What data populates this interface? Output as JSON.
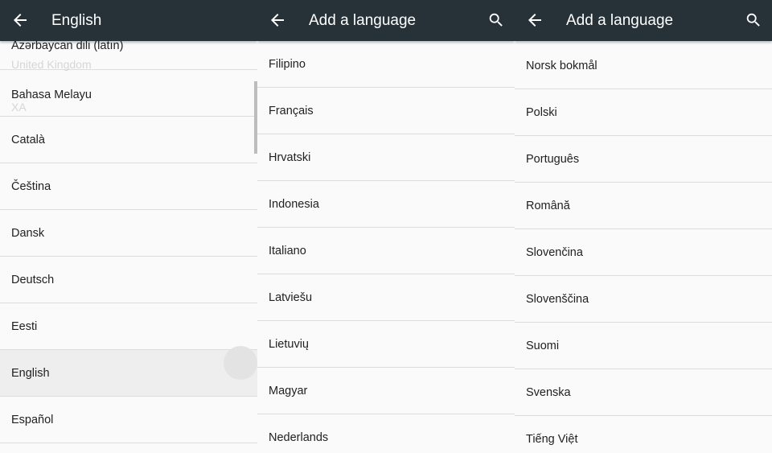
{
  "panel_english": {
    "title": "English",
    "items": [
      {
        "label": "Azərbaycan dili (latın)",
        "sub": "United Kingdom"
      },
      {
        "label": "Bahasa Melayu",
        "sub": "XA"
      },
      {
        "label": "Català"
      },
      {
        "label": "Čeština"
      },
      {
        "label": "Dansk"
      },
      {
        "label": "Deutsch"
      },
      {
        "label": "Eesti"
      },
      {
        "label": "English",
        "selected": true
      },
      {
        "label": "Español"
      }
    ]
  },
  "panel_add_1": {
    "title": "Add a language",
    "items": [
      {
        "label": "Filipino"
      },
      {
        "label": "Français"
      },
      {
        "label": "Hrvatski"
      },
      {
        "label": "Indonesia"
      },
      {
        "label": "Italiano"
      },
      {
        "label": "Latviešu"
      },
      {
        "label": "Lietuvių"
      },
      {
        "label": "Magyar"
      },
      {
        "label": "Nederlands"
      }
    ]
  },
  "panel_add_2": {
    "title": "Add a language",
    "items": [
      {
        "label": "Norsk bokmål"
      },
      {
        "label": "Polski"
      },
      {
        "label": "Português"
      },
      {
        "label": "Română"
      },
      {
        "label": "Slovenčina"
      },
      {
        "label": "Slovenščina"
      },
      {
        "label": "Suomi"
      },
      {
        "label": "Svenska"
      },
      {
        "label": "Tiếng Việt"
      }
    ]
  },
  "icons": {
    "back": "arrow-back-icon",
    "search": "search-icon"
  },
  "colors": {
    "appbar": "#263238",
    "background": "#fafafa",
    "divider": "#dcdcdc",
    "selected_row": "#eeeeee",
    "text": "#212121"
  }
}
